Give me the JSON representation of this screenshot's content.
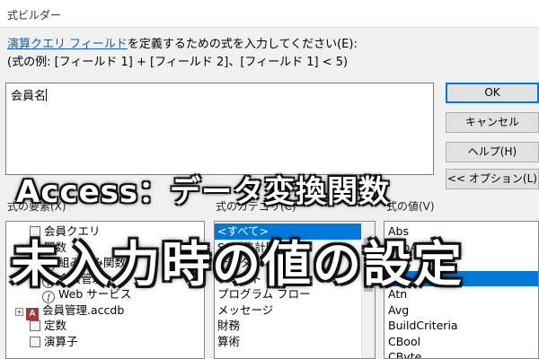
{
  "window": {
    "title": "式ビルダー"
  },
  "instruction": {
    "link": "演算クエリ フィールド",
    "rest": "を定義するための式を入力してください(E):"
  },
  "example": "(式の例: [フィールド 1] + [フィールド 2]、[フィールド 1] < 5)",
  "expression": {
    "value": "会員名"
  },
  "buttons": {
    "ok": "OK",
    "cancel": "キャンセル",
    "help": "ヘルプ(H)",
    "options": "<< オプション(L)"
  },
  "elements": {
    "label": "式の要素(X)",
    "items": [
      {
        "label": "会員クエリ",
        "icon": "query-icon"
      },
      {
        "label": "関数",
        "icon": "folder-icon"
      },
      {
        "label": "組み込み関数",
        "icon": "function-icon"
      },
      {
        "label": "会員管理",
        "icon": "function-icon"
      },
      {
        "label": "Web サービス",
        "icon": "function-icon"
      },
      {
        "label": "会員管理.accdb",
        "icon": "access-db-icon"
      },
      {
        "label": "定数",
        "icon": "folder-icon"
      },
      {
        "label": "演算子",
        "icon": "folder-icon"
      }
    ]
  },
  "categories": {
    "label": "式のカテゴリ(C)",
    "items": [
      "<すべて>",
      "SQL 集計関数",
      "データベース",
      "テキスト",
      "プログラム フロー",
      "メッセージ",
      "財務",
      "算術"
    ],
    "selected_index": 0
  },
  "values": {
    "label": "式の値(V)",
    "items": [
      "Abs",
      "AppActivate",
      "Asc",
      "",
      "Atn",
      "Avg",
      "BuildCriteria",
      "CBool",
      "CByte"
    ],
    "selected_index": 3
  },
  "overlay": {
    "subtitle": "Access：データ変換関数",
    "title": "未入力時の値の設定"
  }
}
